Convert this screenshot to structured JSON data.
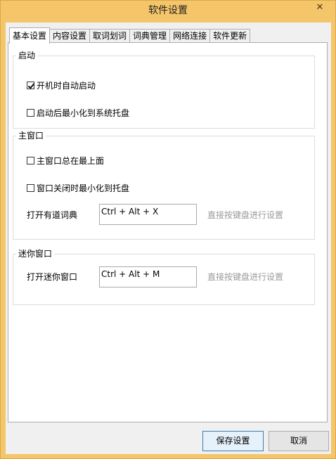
{
  "window": {
    "title": "软件设置",
    "close_glyph": "✕"
  },
  "tabs": [
    {
      "label": "基本设置",
      "active": true
    },
    {
      "label": "内容设置",
      "active": false
    },
    {
      "label": "取词划词",
      "active": false
    },
    {
      "label": "词典管理",
      "active": false
    },
    {
      "label": "网络连接",
      "active": false
    },
    {
      "label": "软件更新",
      "active": false
    }
  ],
  "groups": {
    "startup": {
      "title": "启动",
      "options": [
        {
          "label": "开机时自动启动",
          "checked": true
        },
        {
          "label": "启动后最小化到系统托盘",
          "checked": false
        }
      ]
    },
    "main_window": {
      "title": "主窗口",
      "options": [
        {
          "label": "主窗口总在最上面",
          "checked": false
        },
        {
          "label": "窗口关闭时最小化到托盘",
          "checked": false
        }
      ],
      "hotkey_label": "打开有道词典",
      "hotkey_value": "Ctrl + Alt + X",
      "hint": "直接按键盘进行设置"
    },
    "mini_window": {
      "title": "迷你窗口",
      "hotkey_label": "打开迷你窗口",
      "hotkey_value": "Ctrl + Alt + M",
      "hint": "直接按键盘进行设置"
    }
  },
  "buttons": {
    "save": "保存设置",
    "cancel": "取消"
  }
}
